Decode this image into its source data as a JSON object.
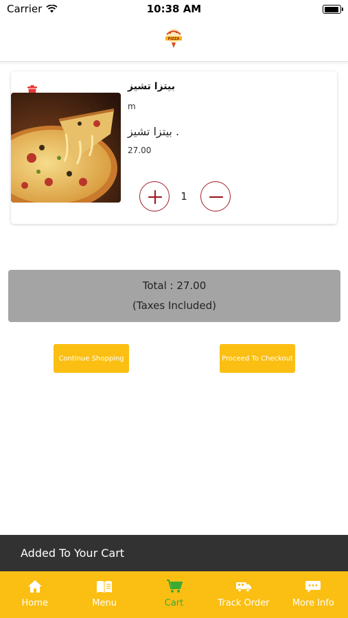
{
  "status_bar": {
    "carrier": "Carrier",
    "time": "10:38 AM",
    "battery_level": 0.95
  },
  "header": {
    "logo_icon": "pizza-logo-icon"
  },
  "cart": {
    "items": [
      {
        "name": "بيتزا تشيز",
        "size": "m",
        "description": "بيتزا تشيز .",
        "price": "27.00",
        "quantity": "1",
        "image": "pizza-image"
      }
    ]
  },
  "summary": {
    "total": "Total : 27.00",
    "taxes_note": "(Taxes Included)"
  },
  "actions": {
    "continue_label": "Continue Shopping",
    "checkout_label": "Proceed To Checkout"
  },
  "snackbar": {
    "message": "Added To Your Cart"
  },
  "tabs": [
    {
      "label": "Home",
      "icon": "home-icon",
      "active": false
    },
    {
      "label": "Menu",
      "icon": "menu-book-icon",
      "active": false
    },
    {
      "label": "Cart",
      "icon": "cart-icon",
      "active": true
    },
    {
      "label": "Track Order",
      "icon": "truck-icon",
      "active": false
    },
    {
      "label": "More Info",
      "icon": "info-chat-icon",
      "active": false
    }
  ],
  "colors": {
    "accent": "#fbbf13",
    "active_tab": "#3aaa35",
    "quantity_button": "#9c1c24",
    "delete_icon": "#e53935",
    "total_box": "#a4a4a4",
    "snackbar": "#323232"
  }
}
